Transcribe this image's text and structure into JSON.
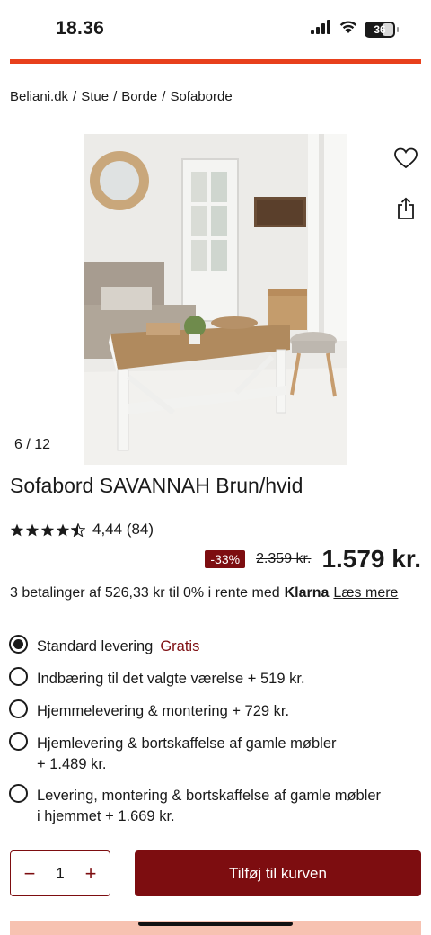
{
  "status": {
    "time": "18.36",
    "battery": "36"
  },
  "breadcrumb": [
    "Beliani.dk",
    "Stue",
    "Borde",
    "Sofaborde"
  ],
  "gallery": {
    "counter_current": "6",
    "counter_separator": "/",
    "counter_total": "12"
  },
  "product": {
    "title": "Sofabord SAVANNAH Brun/hvid",
    "rating_value": "4,44 (84)",
    "stars_filled": 4.44,
    "discount": "-33%",
    "old_price": "2.359  kr.",
    "price": "1.579 kr."
  },
  "installments": {
    "text": "3 betalinger af 526,33 kr til 0% i rente med",
    "provider": "Klarna",
    "link": "Læs mere"
  },
  "delivery": {
    "options": [
      {
        "label": "Standard levering",
        "extra": "Gratis",
        "checked": true
      },
      {
        "label": "Indbæring til det valgte værelse + 519 kr."
      },
      {
        "label": "Hjemmelevering & montering + 729 kr."
      },
      {
        "label_line1": "Hjemlevering & bortskaffelse af gamle møbler",
        "label_line2": "+ 1.489 kr."
      },
      {
        "label_line1": "Levering, montering & bortskaffelse af gamle møbler",
        "label_line2": "i hjemmet + 1.669 kr."
      }
    ]
  },
  "cart": {
    "minus": "−",
    "quantity": "1",
    "plus": "+",
    "button": "Tilføj til kurven"
  },
  "colors": {
    "accent": "#e8401c",
    "brand": "#7d0d10"
  },
  "icons": [
    "signal-icon",
    "wifi-icon",
    "battery-icon",
    "heart-icon",
    "share-icon",
    "star-icon",
    "radio-icon"
  ]
}
